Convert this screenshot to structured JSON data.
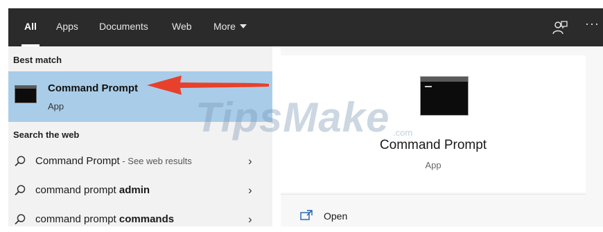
{
  "tabs": [
    "All",
    "Apps",
    "Documents",
    "Web",
    "More"
  ],
  "best_match": {
    "header": "Best match",
    "title": "Command Prompt",
    "subtitle": "App"
  },
  "search_web": {
    "header": "Search the web",
    "items": [
      {
        "text": "Command Prompt",
        "bold": "",
        "hint": " - See web results"
      },
      {
        "text": "command prompt ",
        "bold": "admin",
        "hint": ""
      },
      {
        "text": "command prompt ",
        "bold": "commands",
        "hint": ""
      }
    ]
  },
  "detail": {
    "title": "Command Prompt",
    "subtitle": "App",
    "actions": [
      "Open"
    ]
  },
  "watermark": {
    "text": "TipsMake",
    "suffix": ".com"
  },
  "icons": {
    "feedback": "feedback-person-icon",
    "more": "ellipsis-icon",
    "search": "magnifier-icon",
    "chevron": "chevron-right-icon",
    "open": "open-window-icon"
  },
  "colors": {
    "topbar": "#2b2b2b",
    "selected_row": "#a9cde8",
    "left_panel": "#f2f2f2",
    "arrow": "#e8412b"
  }
}
